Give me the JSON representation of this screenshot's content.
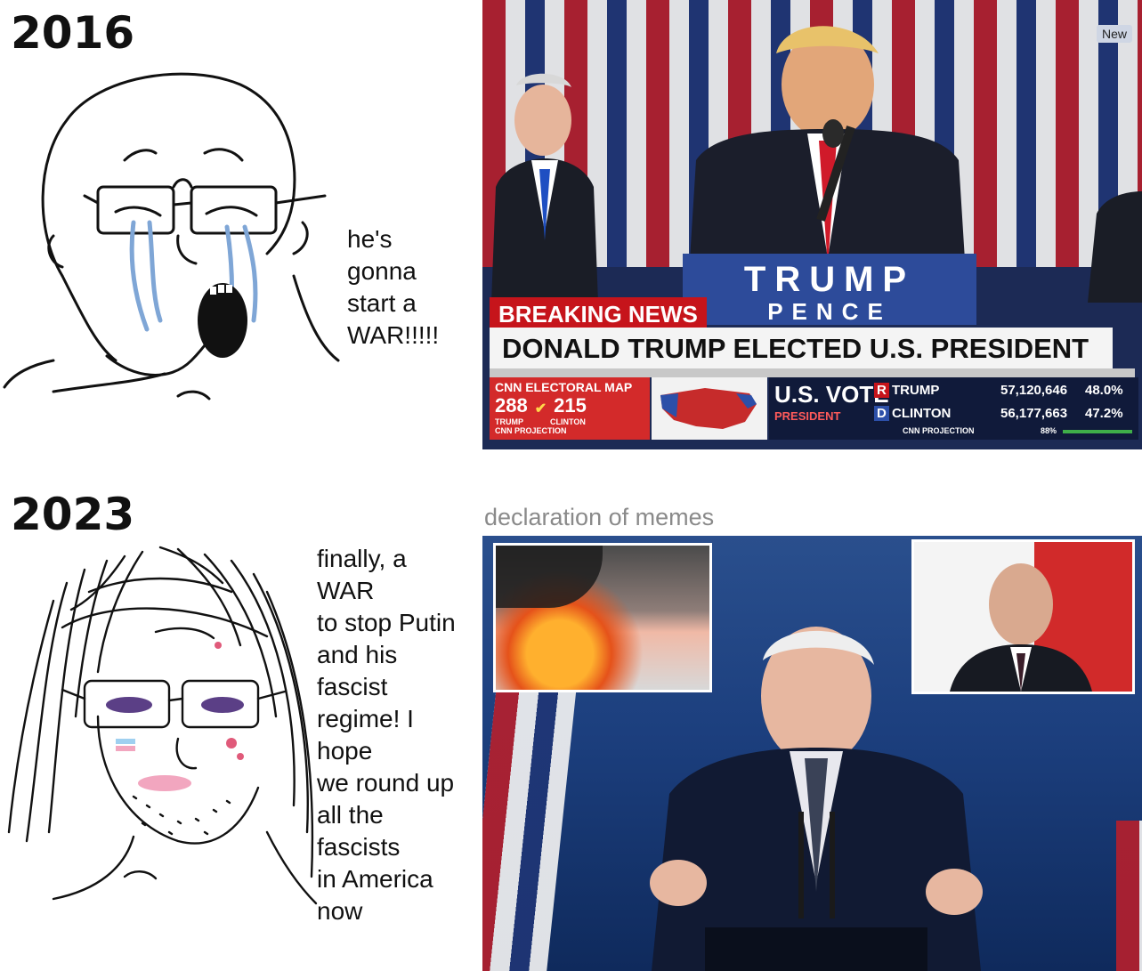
{
  "panels": [
    {
      "year": "2016",
      "caption": "he's\ngonna\nstart a\nWAR!!!!!",
      "photo": {
        "podium_top": "TRUMP",
        "podium_bottom": "PENCE",
        "breaking_label": "BREAKING NEWS",
        "headline": "DONALD TRUMP ELECTED U.S. PRESIDENT",
        "new_tag": "New",
        "electoral_map_label": "CNN ELECTORAL MAP",
        "trump_ev": "288",
        "clinton_ev": "215",
        "trump_small": "TRUMP",
        "clinton_small": "CLINTON",
        "projection": "CNN PROJECTION",
        "us_vote": "U.S. VOTE",
        "president": "PRESIDENT",
        "r_mark": "R",
        "d_mark": "D",
        "cand1": "TRUMP",
        "cand1_votes": "57,120,646",
        "cand1_pct": "48.0%",
        "cand2": "CLINTON",
        "cand2_votes": "56,177,663",
        "cand2_pct": "47.2%",
        "projection2": "CNN PROJECTION",
        "reporting": "88%"
      }
    },
    {
      "year": "2023",
      "caption": "finally, a\nWAR\nto stop Putin\nand his\nfascist\nregime! I\nhope\nwe round up\nall the\nfascists\nin America\nnow",
      "watermark": "declaration of memes"
    }
  ],
  "colors": {
    "breaking_red": "#c6141b",
    "podium_blue": "#2d4b9a",
    "tear_blue": "#7fa6d6",
    "blush_pink": "#f2a6bf"
  }
}
